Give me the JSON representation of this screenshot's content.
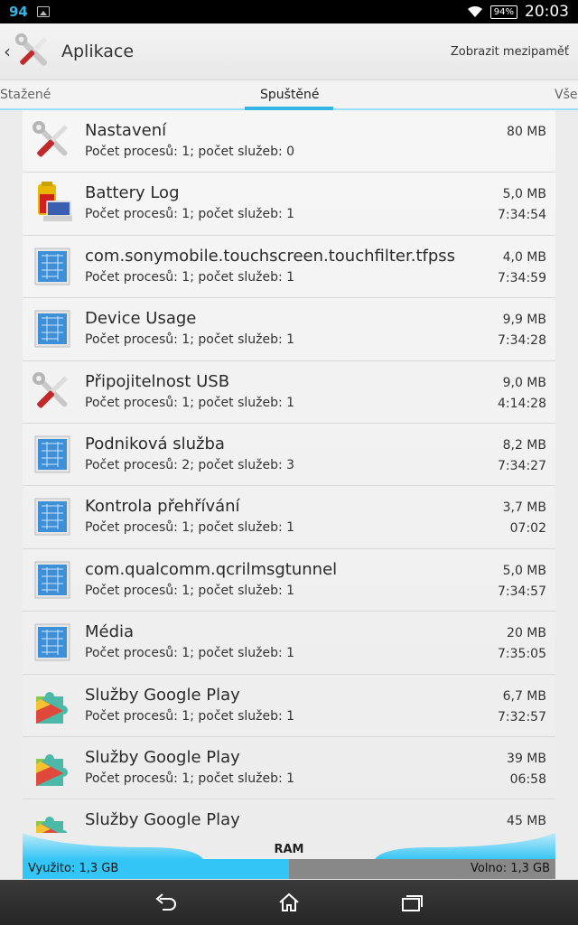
{
  "status_bar": {
    "left_number": "94",
    "battery": "94%",
    "time": "20:03",
    "icons": [
      "image-notification-icon",
      "wifi-icon",
      "battery-icon"
    ]
  },
  "action_bar": {
    "title": "Aplikace",
    "action": "Zobrazit mezipaměť",
    "back_icon": "chevron-left-icon",
    "app_icon": "settings-tools-icon"
  },
  "tabs": [
    "Stažené",
    "Spuštěné",
    "Vše"
  ],
  "active_tab": "Spuštěné",
  "apps": [
    {
      "name": "Nastavení",
      "detail": "Počet procesů: 1; počet služeb: 0",
      "size": "80 MB",
      "time": "",
      "icon": "tools"
    },
    {
      "name": "Battery Log",
      "detail": "Počet procesů: 1; počet služeb: 1",
      "size": "5,0 MB",
      "time": "7:34:54",
      "icon": "battery"
    },
    {
      "name": "com.sonymobile.touchscreen.touchfilter.tfpss",
      "detail": "Počet procesů: 1; počet služeb: 1",
      "size": "4,0 MB",
      "time": "7:34:59",
      "icon": "blueprint"
    },
    {
      "name": "Device Usage",
      "detail": "Počet procesů: 1; počet služeb: 1",
      "size": "9,9 MB",
      "time": "7:34:28",
      "icon": "blueprint"
    },
    {
      "name": "Připojitelnost USB",
      "detail": "Počet procesů: 1; počet služeb: 1",
      "size": "9,0 MB",
      "time": "4:14:28",
      "icon": "tools"
    },
    {
      "name": "Podniková služba",
      "detail": "Počet procesů: 2; počet služeb: 3",
      "size": "8,2 MB",
      "time": "7:34:27",
      "icon": "blueprint"
    },
    {
      "name": "Kontrola přehřívání",
      "detail": "Počet procesů: 1; počet služeb: 1",
      "size": "3,7 MB",
      "time": "07:02",
      "icon": "blueprint"
    },
    {
      "name": "com.qualcomm.qcrilmsgtunnel",
      "detail": "Počet procesů: 1; počet služeb: 1",
      "size": "5,0 MB",
      "time": "7:34:57",
      "icon": "blueprint"
    },
    {
      "name": "Média",
      "detail": "Počet procesů: 1; počet služeb: 1",
      "size": "20 MB",
      "time": "7:35:05",
      "icon": "blueprint"
    },
    {
      "name": "Služby Google Play",
      "detail": "Počet procesů: 1; počet služeb: 1",
      "size": "6,7 MB",
      "time": "7:32:57",
      "icon": "puzzle"
    },
    {
      "name": "Služby Google Play",
      "detail": "Počet procesů: 1; počet služeb: 1",
      "size": "39 MB",
      "time": "06:58",
      "icon": "puzzle"
    },
    {
      "name": "Služby Google Play",
      "detail": "",
      "size": "45 MB",
      "time": "",
      "icon": "puzzle"
    }
  ],
  "ram": {
    "label": "RAM",
    "used": "Využito: 1,3 GB",
    "free": "Volno: 1,3 GB",
    "used_fraction": 0.5
  },
  "nav_bar": [
    "back-icon",
    "home-icon",
    "recents-icon"
  ],
  "colors": {
    "accent": "#33b5e5",
    "ram_used": "#33c5f5",
    "ram_free": "#888888"
  }
}
